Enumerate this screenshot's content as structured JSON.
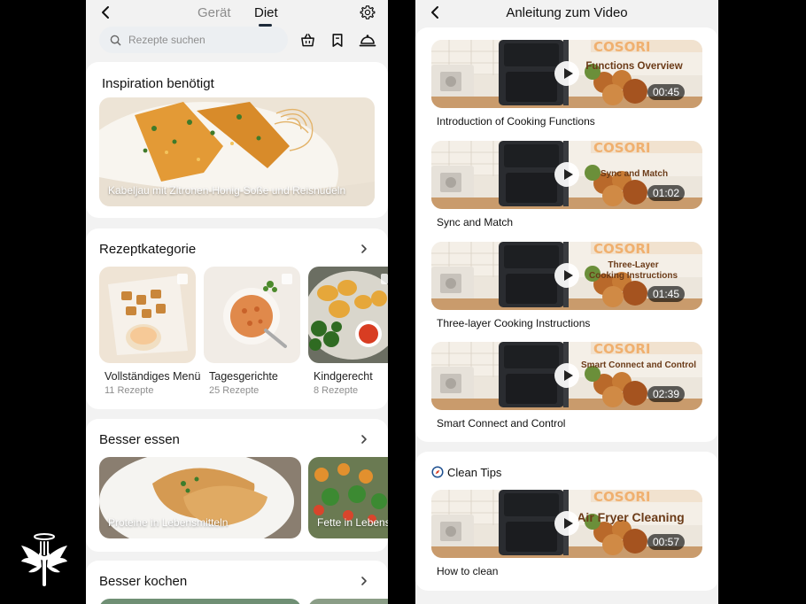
{
  "left": {
    "tabs": [
      {
        "label": "Gerät"
      },
      {
        "label": "Diet"
      }
    ],
    "search": {
      "placeholder": "Rezepte suchen"
    },
    "inspiration": {
      "title": "Inspiration benötigt",
      "featured": "Kabeljau mit Zitronen-Honig-Soße und Reisnudeln"
    },
    "categories": {
      "title": "Rezeptkategorie",
      "items": [
        {
          "name": "Vollständiges Menü",
          "count": "11 Rezepte"
        },
        {
          "name": "Tagesgerichte",
          "count": "25 Rezepte"
        },
        {
          "name": "Kindgerecht",
          "count": "8 Rezepte"
        }
      ]
    },
    "better_eating": {
      "title": "Besser essen",
      "items": [
        {
          "label": "Proteine in Lebensmitteln"
        },
        {
          "label": "Fette in Lebens"
        }
      ]
    },
    "better_cooking": {
      "title": "Besser kochen"
    }
  },
  "right": {
    "title": "Anleitung zum Video",
    "brand": "COSORI",
    "videos": [
      {
        "overlay": "Functions Overview",
        "duration": "00:45",
        "title": "Introduction of Cooking Functions"
      },
      {
        "overlay": "Sync and Match",
        "duration": "01:02",
        "title": "Sync and Match"
      },
      {
        "overlay": "Three-Layer Cooking Instructions",
        "duration": "01:45",
        "title": "Three-layer Cooking Instructions"
      },
      {
        "overlay": "Smart Connect and Control",
        "duration": "02:39",
        "title": "Smart Connect and Control"
      }
    ],
    "clean": {
      "title": "Clean Tips",
      "video": {
        "overlay": "Air Fryer Cleaning",
        "duration": "00:57",
        "title": "How to clean"
      }
    }
  },
  "colors": {
    "accent": "#1d2a3a",
    "brand": "#e8893a",
    "muted": "#8e8e8e",
    "background": "#f2f2f2"
  },
  "icons": [
    "back-icon",
    "gear-icon",
    "search-icon",
    "basket-icon",
    "bookmark-icon",
    "cloche-icon",
    "chevron-right-icon",
    "play-icon",
    "compass-icon",
    "fork-angel-logo"
  ]
}
